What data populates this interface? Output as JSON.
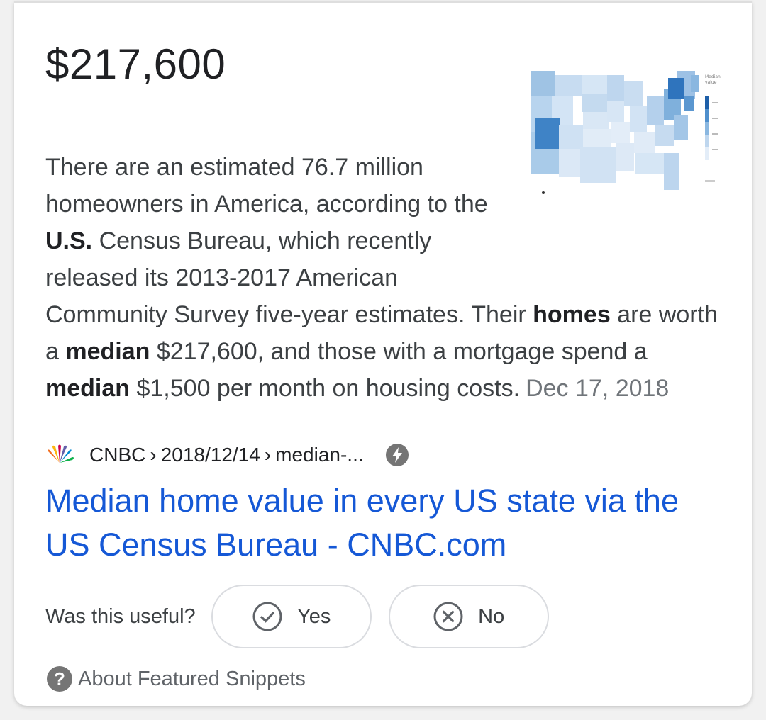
{
  "featured_snippet": {
    "answer": "$217,600",
    "snippet": {
      "part1": "There are an estimated 76.7 million homeowners in America, according to the ",
      "bold1": "U.S.",
      "part2": " Census Bureau, which recently released its 2013-2017 American Community Survey five-year estimates. Their ",
      "bold2": "homes",
      "part3": " are worth a ",
      "bold3": "median",
      "part4": " $217,600, and those with a mortgage spend a ",
      "bold4": "median",
      "part5": " $1,500 per month on housing costs.",
      "date": "Dec 17, 2018"
    },
    "thumbnail_icon": "us-map-thumbnail",
    "source": {
      "site": "CNBC",
      "path1": "2018/12/14",
      "path2": "median-...",
      "separator": "›",
      "logo_icon": "nbc-peacock-icon",
      "amp_icon": "amp-lightning-icon"
    },
    "title": "Median home value in every US state via the US Census Bureau - CNBC.com",
    "feedback": {
      "question": "Was this useful?",
      "yes_label": "Yes",
      "no_label": "No"
    },
    "about_label": "About Featured Snippets",
    "colors": {
      "link": "#1558d6",
      "text": "#3c4043",
      "muted": "#70757a"
    }
  }
}
